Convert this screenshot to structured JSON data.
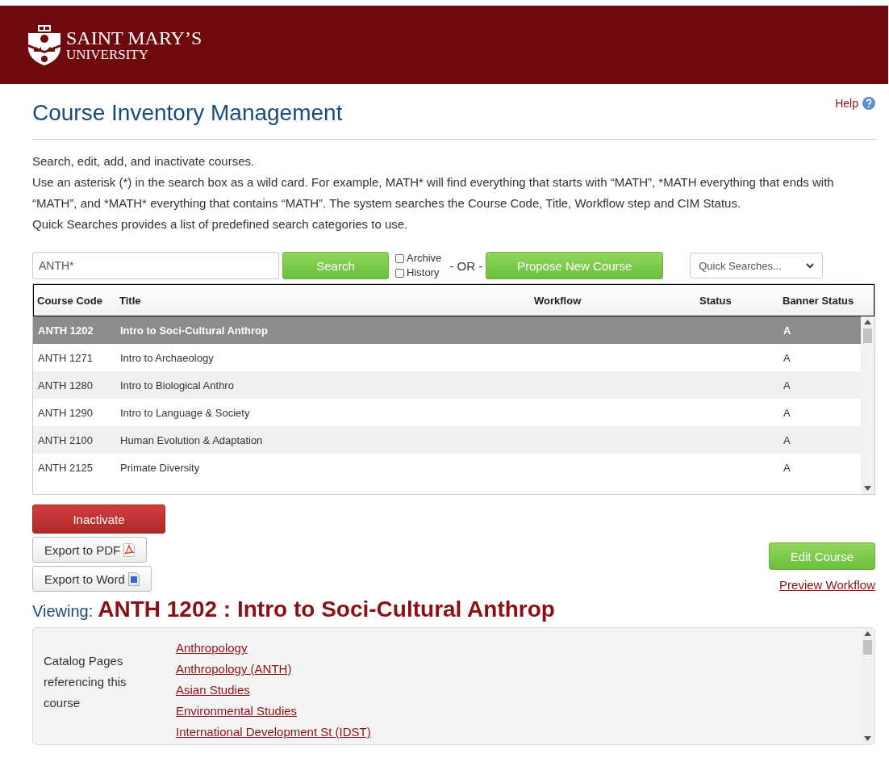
{
  "header": {
    "logo_line_1": "SAINT MARY’S",
    "logo_line_2": "UNIVERSITY"
  },
  "page": {
    "title": "Course Inventory Management",
    "help": "Help"
  },
  "intro": [
    "Search, edit, add, and inactivate courses.",
    "Use an asterisk (*) in the search box as a wild card. For example, MATH* will find everything that starts with “MATH”, *MATH everything that ends with “MATH”, and *MATH* everything that contains “MATH”. The system searches the Course Code, Title, Workflow step and CIM Status.",
    "Quick Searches provides a list of predefined search categories to use."
  ],
  "search": {
    "value": "ANTH*",
    "button": "Search",
    "options": [
      {
        "label": "Archive",
        "checked": false
      },
      {
        "label": "History",
        "checked": false
      }
    ],
    "or": "- OR -",
    "propose": "Propose New Course",
    "quick_searches": {
      "placeholder": "Quick Searches..."
    }
  },
  "table": {
    "columns": [
      "Course Code",
      "Title",
      "Workflow",
      "Status",
      "Banner Status"
    ],
    "rows": [
      {
        "code": "ANTH 1202",
        "title": "Intro to Soci-Cultural Anthrop",
        "banner_status": "A",
        "selected": true
      },
      {
        "code": "ANTH 1271",
        "title": "Intro to Archaeology",
        "banner_status": "A",
        "selected": false
      },
      {
        "code": "ANTH 1280",
        "title": "Intro to Biological Anthro",
        "banner_status": "A",
        "selected": false
      },
      {
        "code": "ANTH 1290",
        "title": "Intro to Language & Society",
        "banner_status": "A",
        "selected": false
      },
      {
        "code": "ANTH 2100",
        "title": "Human Evolution & Adaptation",
        "banner_status": "A",
        "selected": false
      },
      {
        "code": "ANTH 2125",
        "title": "Primate Diversity",
        "banner_status": "A",
        "selected": false
      }
    ]
  },
  "actions": {
    "inactivate": "Inactivate",
    "export_pdf": "Export to PDF",
    "export_word": "Export to Word",
    "edit_course": "Edit Course",
    "preview_workflow": "Preview Workflow"
  },
  "viewing": {
    "label": "Viewing:",
    "course": "ANTH 1202 : Intro to Soci-Cultural Anthrop"
  },
  "catalog": {
    "label": "Catalog Pages referencing this course",
    "links": [
      "Anthropology",
      "Anthropology (ANTH)",
      "Asian Studies",
      "Environmental Studies",
      "International Development St (IDST)"
    ]
  }
}
